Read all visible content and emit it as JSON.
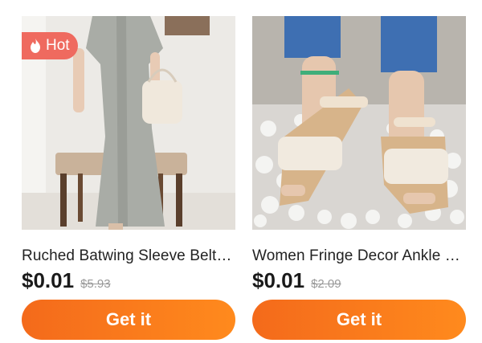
{
  "products": [
    {
      "badge": "Hot",
      "badge_icon": "flame-icon",
      "title": "Ruched Batwing Sleeve Belte...",
      "price": "$0.01",
      "original_price": "$5.93",
      "button_label": "Get it"
    },
    {
      "title": "Women Fringe Decor Ankle S...",
      "price": "$0.01",
      "original_price": "$2.09",
      "button_label": "Get it"
    }
  ],
  "colors": {
    "button_gradient_start": "#f46a1b",
    "button_gradient_end": "#ff8a1d",
    "badge_background": "#ef6a5f"
  }
}
